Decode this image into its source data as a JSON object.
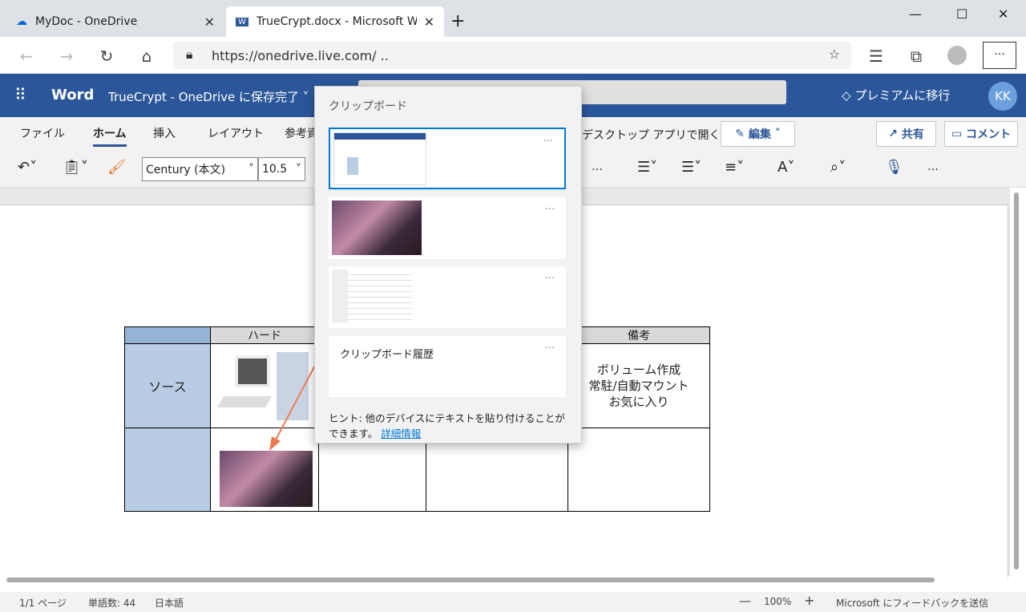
{
  "browser": {
    "tabs": [
      {
        "label": "MyDoc - OneDrive",
        "icon": "onedrive-icon"
      },
      {
        "label": "TrueCrypt.docx - Microsoft Word",
        "icon": "word-icon"
      }
    ],
    "url": "https://onedrive.live.com/ .."
  },
  "word": {
    "app": "Word",
    "doc_title": "TrueCrypt - OneDrive に保存完了",
    "premium": "プレミアムに移行",
    "avatar": "KK",
    "menu": [
      "ファイル",
      "ホーム",
      "挿入",
      "レイアウト",
      "参考資"
    ],
    "active_menu": "ホーム",
    "open_desktop": "デスクトップ アプリで開く",
    "edit": "編集",
    "share": "共有",
    "comment": "コメント",
    "font": "Century (本文)",
    "size": "10.5",
    "more": "…"
  },
  "clipboard": {
    "title": "クリップボード",
    "items": [
      "",
      "",
      "",
      ""
    ],
    "history": "クリップボード履歴",
    "more": "…",
    "hint": "ヒント: 他のデバイスにテキストを貼り付けることができます。",
    "link": "詳細情報"
  },
  "table": {
    "header": [
      "",
      "ハード",
      "",
      "",
      "備考"
    ],
    "row1_label": "ソース",
    "notes": [
      "ボリューム作成",
      "常駐/自動マウント",
      "お気に入り"
    ]
  },
  "status": {
    "page": "1/1 ページ",
    "words": "単語数: 44",
    "lang": "日本語",
    "zoom": "100%",
    "feedback": "Microsoft にフィードバックを送信"
  },
  "colors": {
    "word_blue": "#2b579a",
    "header_cell": "#b8cce4",
    "accent": "#0078d4"
  }
}
